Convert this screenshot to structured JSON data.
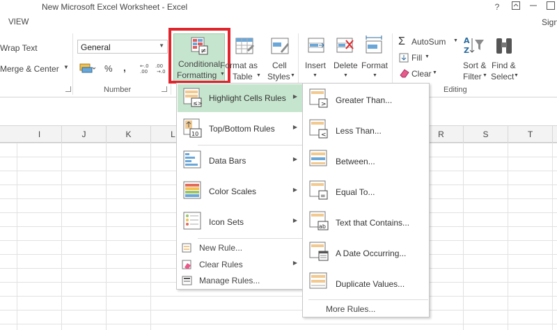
{
  "window": {
    "title": "New Microsoft Excel Worksheet - Excel",
    "help": "?"
  },
  "tabs": {
    "view": "VIEW",
    "signin": "Sign"
  },
  "ribbon": {
    "wrap_text": "Wrap Text",
    "merge_center": "Merge & Center",
    "number_format_value": "General",
    "percent": "%",
    "comma": ",",
    "number_group": "Number",
    "cf_line1": "Conditional",
    "cf_line2": "Formatting",
    "format_table_line1": "Format as",
    "format_table_line2": "Table",
    "cell_styles_line1": "Cell",
    "cell_styles_line2": "Styles",
    "insert": "Insert",
    "delete": "Delete",
    "format": "Format",
    "autosum": "AutoSum",
    "fill": "Fill",
    "clear": "Clear",
    "sort_filter_line1": "Sort &",
    "sort_filter_line2": "Filter",
    "find_select_line1": "Find &",
    "find_select_line2": "Select",
    "editing_group": "Editing"
  },
  "columns": [
    "I",
    "J",
    "K",
    "L",
    "R",
    "S",
    "T"
  ],
  "cf_menu": {
    "items": [
      {
        "label": "Highlight Cells Rules",
        "icon": "highlight-cells-icon"
      },
      {
        "label": "Top/Bottom Rules",
        "icon": "top-bottom-icon"
      },
      {
        "label": "Data Bars",
        "icon": "data-bars-icon"
      },
      {
        "label": "Color Scales",
        "icon": "color-scales-icon"
      },
      {
        "label": "Icon Sets",
        "icon": "icon-sets-icon"
      }
    ],
    "small_items": [
      {
        "label": "New Rule...",
        "icon": "new-rule-icon"
      },
      {
        "label": "Clear Rules",
        "icon": "clear-rules-icon"
      },
      {
        "label": "Manage Rules...",
        "icon": "manage-rules-icon"
      }
    ]
  },
  "highlight_menu": {
    "items": [
      {
        "label": "Greater Than...",
        "icon": "greater-than-icon"
      },
      {
        "label": "Less Than...",
        "icon": "less-than-icon"
      },
      {
        "label": "Between...",
        "icon": "between-icon"
      },
      {
        "label": "Equal To...",
        "icon": "equal-to-icon"
      },
      {
        "label": "Text that Contains...",
        "icon": "text-contains-icon"
      },
      {
        "label": "A Date Occurring...",
        "icon": "date-occurring-icon"
      },
      {
        "label": "Duplicate Values...",
        "icon": "duplicate-values-icon"
      }
    ],
    "more_rules": "More Rules..."
  },
  "colors": {
    "accent_green": "#c6e5ce",
    "highlight_red": "#e0262c"
  }
}
